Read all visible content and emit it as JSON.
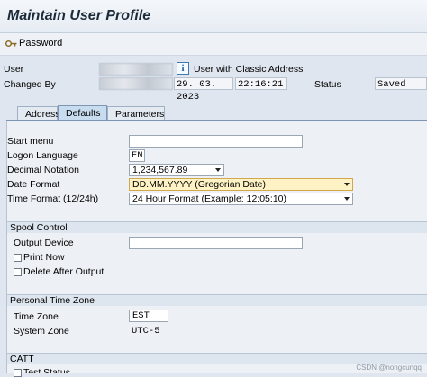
{
  "window": {
    "title": "Maintain User Profile"
  },
  "toolbar": {
    "password_label": "Password"
  },
  "header": {
    "user_label": "User",
    "user_value": "",
    "classic_address_label": "User with Classic Address",
    "changed_by_label": "Changed By",
    "changed_by_value": "",
    "changed_date": "29. 03. 2023",
    "changed_time": "22:16:21",
    "status_label": "Status",
    "status_value": "Saved"
  },
  "tabs": [
    {
      "label": "Address",
      "active": false
    },
    {
      "label": "Defaults",
      "active": true
    },
    {
      "label": "Parameters",
      "active": false
    }
  ],
  "defaults": {
    "start_menu_label": "Start menu",
    "start_menu_value": "",
    "logon_language_label": "Logon Language",
    "logon_language_value": "EN",
    "decimal_notation_label": "Decimal Notation",
    "decimal_notation_value": "1,234,567.89",
    "date_format_label": "Date Format",
    "date_format_value": "DD.MM.YYYY (Gregorian Date)",
    "time_format_label": "Time Format (12/24h)",
    "time_format_value": "24 Hour Format (Example: 12:05:10)"
  },
  "spool": {
    "title": "Spool Control",
    "output_device_label": "Output Device",
    "output_device_value": "",
    "print_now_label": "Print Now",
    "print_now_checked": false,
    "delete_after_output_label": "Delete After Output",
    "delete_after_output_checked": false
  },
  "time_zone": {
    "title": "Personal Time Zone",
    "time_zone_label": "Time Zone",
    "time_zone_value": "EST",
    "system_zone_label": "System Zone",
    "system_zone_value": "UTC-5"
  },
  "catt": {
    "title": "CATT",
    "test_status_label": "Test Status"
  },
  "watermark": "CSDN @nongcunqq",
  "colors": {
    "accent": "#c8dcf0",
    "highlight": "#fff3c6",
    "background": "#dfe6ef"
  },
  "icons": [
    "key-icon",
    "info-icon",
    "dropdown-arrow-icon"
  ]
}
